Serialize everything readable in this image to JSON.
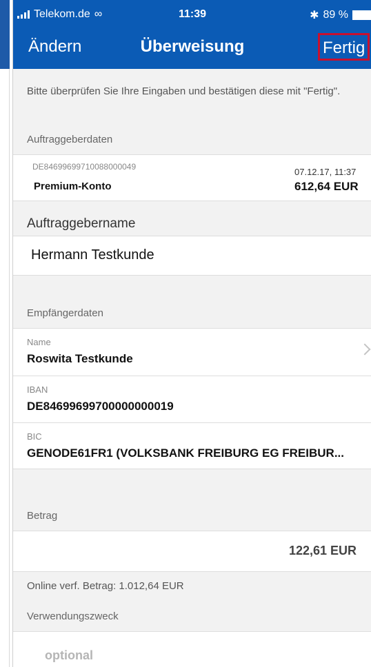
{
  "status": {
    "carrier": "Telekom.de",
    "time": "11:39",
    "battery": "89 %"
  },
  "nav": {
    "back_label": "Ändern",
    "title": "Überweisung",
    "done_label": "Fertig"
  },
  "intro_text": "Bitte überprüfen Sie Ihre Eingaben und bestätigen diese mit \"Fertig\".",
  "sender": {
    "section_label": "Auftraggeberdaten",
    "account_number": "DE84699699710088000049",
    "account_name": "Premium-Konto",
    "date": "07.12.17, 11:37",
    "balance": "612,64 EUR",
    "name_label": "Auftraggebername",
    "name_value": "Hermann Testkunde"
  },
  "recipient": {
    "section_label": "Empfängerdaten",
    "name_label": "Name",
    "name_value": "Roswita Testkunde",
    "iban_label": "IBAN",
    "iban_value": "DE84699699700000000019",
    "bic_label": "BIC",
    "bic_value": "GENODE61FR1 (VOLKSBANK FREIBURG EG FREIBUR..."
  },
  "amount": {
    "section_label": "Betrag",
    "value": "122,61 EUR",
    "online_text": "Online verf. Betrag: 1.012,64 EUR"
  },
  "purpose": {
    "section_label": "Verwendungszweck",
    "placeholder": "optional"
  },
  "colors": {
    "header_blue": "#0b5bb5",
    "highlight_red": "#c8102e"
  }
}
